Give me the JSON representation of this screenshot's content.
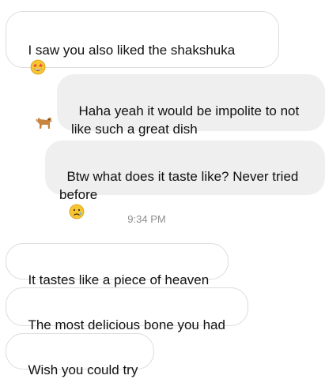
{
  "messages": [
    {
      "direction": "incoming",
      "text": "I saw you also liked the shakshuka",
      "emoji_after_text": "star-struck-emoji",
      "second_line_emoji": "dog-emoji"
    },
    {
      "direction": "outgoing",
      "text": "Haha yeah it would be impolite to not\nlike such a great dish"
    },
    {
      "direction": "outgoing",
      "text": "Btw what does it taste like? Never tried\nbefore",
      "emoji_after_text": "crying-face-emoji"
    },
    {
      "direction": "incoming",
      "text": "It tastes like a piece of heaven"
    },
    {
      "direction": "incoming",
      "text": "The most delicious bone you had"
    },
    {
      "direction": "incoming",
      "text": "Wish you could try"
    }
  ],
  "timestamp": "9:34 PM",
  "colors": {
    "incoming_bg": "#ffffff",
    "incoming_border": "#dddddd",
    "outgoing_bg": "#efefef",
    "text": "#111111",
    "timestamp": "#8e8e8e"
  }
}
